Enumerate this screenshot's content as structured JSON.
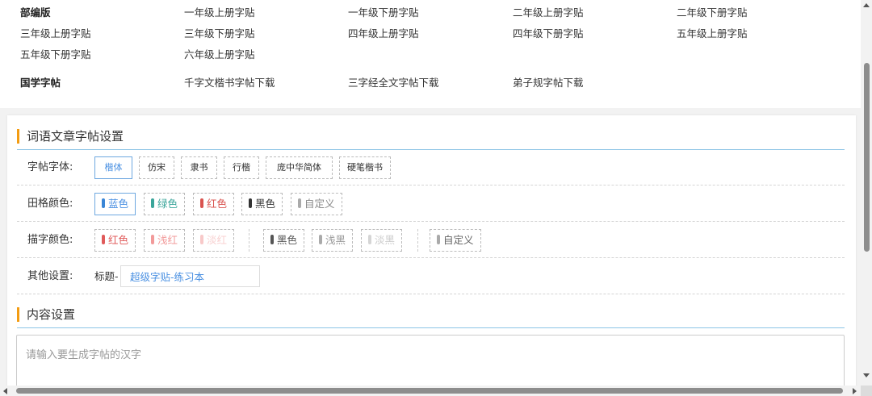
{
  "links": {
    "rows": [
      [
        "部编版",
        "一年级上册字贴",
        "一年级下册字贴",
        "二年级上册字贴",
        "二年级下册字贴"
      ],
      [
        "三年级上册字贴",
        "三年级下册字贴",
        "四年级上册字贴",
        "四年级下册字贴",
        "五年级上册字贴"
      ],
      [
        "五年级下册字贴",
        "六年级上册字贴"
      ],
      [
        "国学字帖",
        "千字文楷书字帖下载",
        "三字经全文字帖下载",
        "弟子规字帖下载"
      ]
    ]
  },
  "settings": {
    "section_title": "词语文章字帖设置",
    "font_label": "字帖字体:",
    "font_options": [
      "楷体",
      "仿宋",
      "隶书",
      "行楷",
      "庞中华简体",
      "硬笔楷书"
    ],
    "grid_color_label": "田格颜色:",
    "grid_colors": [
      {
        "label": "蓝色",
        "color": "#3a86d6"
      },
      {
        "label": "绿色",
        "color": "#3aa59a"
      },
      {
        "label": "红色",
        "color": "#d9534f"
      },
      {
        "label": "黑色",
        "color": "#333333"
      },
      {
        "label": "自定义",
        "color": "#aaaaaa"
      }
    ],
    "trace_color_label": "描字颜色:",
    "trace_colors": [
      {
        "label": "红色",
        "color": "#e05a5a",
        "text": "#e05a5a"
      },
      {
        "label": "浅红",
        "color": "#f29a9a",
        "text": "#f29a9a"
      },
      {
        "label": "淡红",
        "color": "#f8c9c9",
        "text": "#f8d0d0"
      },
      {
        "label": "黑色",
        "color": "#555555",
        "text": "#555555"
      },
      {
        "label": "浅黑",
        "color": "#aaaaaa",
        "text": "#999999"
      },
      {
        "label": "淡黑",
        "color": "#d5d5d5",
        "text": "#cccccc"
      },
      {
        "label": "自定义",
        "color": "#aaaaaa",
        "text": "#666666"
      }
    ],
    "other_label": "其他设置:",
    "title_prefix": "标题-",
    "title_value": "超级字贴-练习本"
  },
  "content": {
    "section_title": "内容设置",
    "placeholder": "请输入要生成字帖的汉字"
  },
  "colors": {
    "accent": "#f39c12",
    "selected": "#4a90e2",
    "section_line": "#8cc4e6"
  }
}
